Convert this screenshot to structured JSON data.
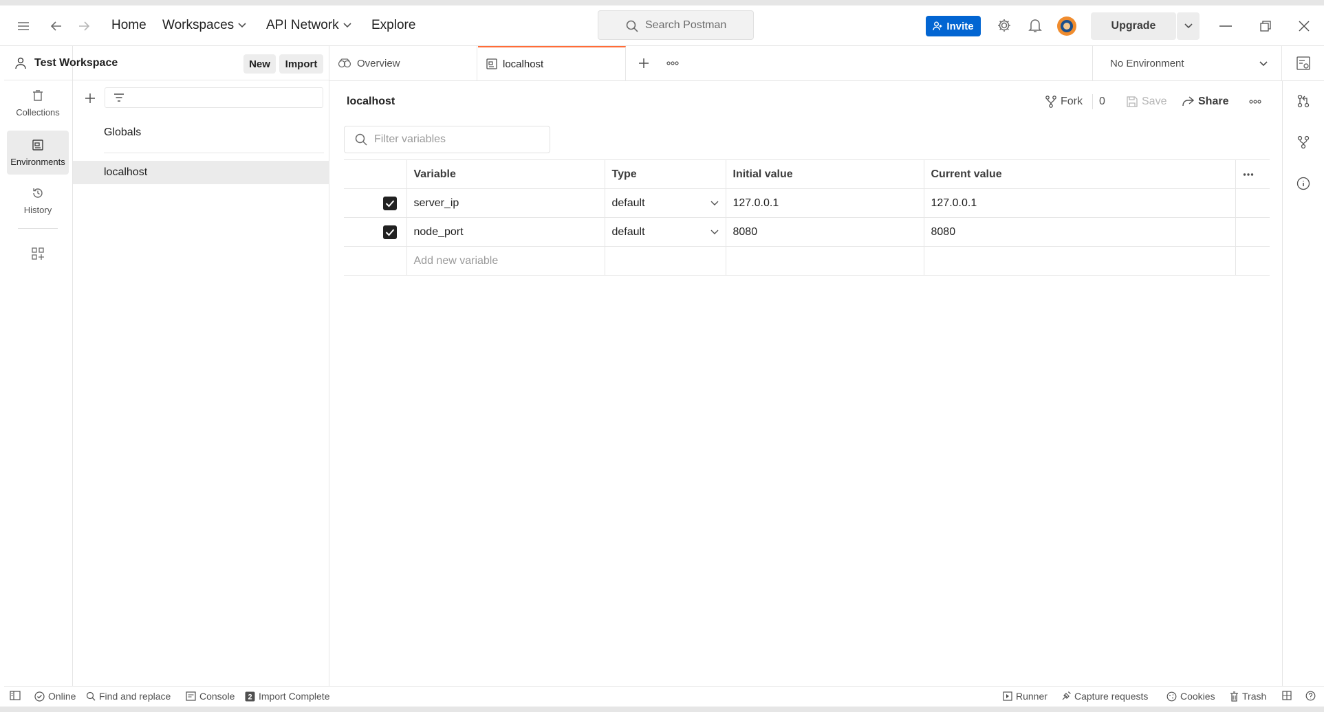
{
  "topbar": {
    "nav": {
      "home": "Home",
      "workspaces": "Workspaces",
      "api_network": "API Network",
      "explore": "Explore"
    },
    "search_placeholder": "Search Postman",
    "invite": "Invite",
    "upgrade": "Upgrade"
  },
  "workspace": {
    "name": "Test Workspace",
    "new_label": "New",
    "import_label": "Import"
  },
  "rail": {
    "collections": "Collections",
    "environments": "Environments",
    "history": "History"
  },
  "environments": {
    "items": [
      "Globals",
      "localhost"
    ],
    "selected": "localhost"
  },
  "tabs": [
    {
      "label": "Overview"
    },
    {
      "label": "localhost"
    }
  ],
  "env_select": {
    "value": "No Environment"
  },
  "main": {
    "title": "localhost",
    "fork": "Fork",
    "fork_count": "0",
    "save": "Save",
    "share": "Share",
    "filter_placeholder": "Filter variables",
    "columns": [
      "Variable",
      "Type",
      "Initial value",
      "Current value"
    ],
    "rows": [
      {
        "variable": "server_ip",
        "type": "default",
        "initial": "127.0.0.1",
        "current": "127.0.0.1",
        "enabled": true
      },
      {
        "variable": "node_port",
        "type": "default",
        "initial": "8080",
        "current": "8080",
        "enabled": true
      }
    ],
    "add_placeholder": "Add new variable"
  },
  "statusbar": {
    "online": "Online",
    "find_replace": "Find and replace",
    "console": "Console",
    "import_complete": "Import Complete",
    "runner": "Runner",
    "capture": "Capture requests",
    "cookies": "Cookies",
    "trash": "Trash"
  },
  "colors": {
    "accent": "#ff6c37",
    "invite_blue": "#0265d2"
  }
}
